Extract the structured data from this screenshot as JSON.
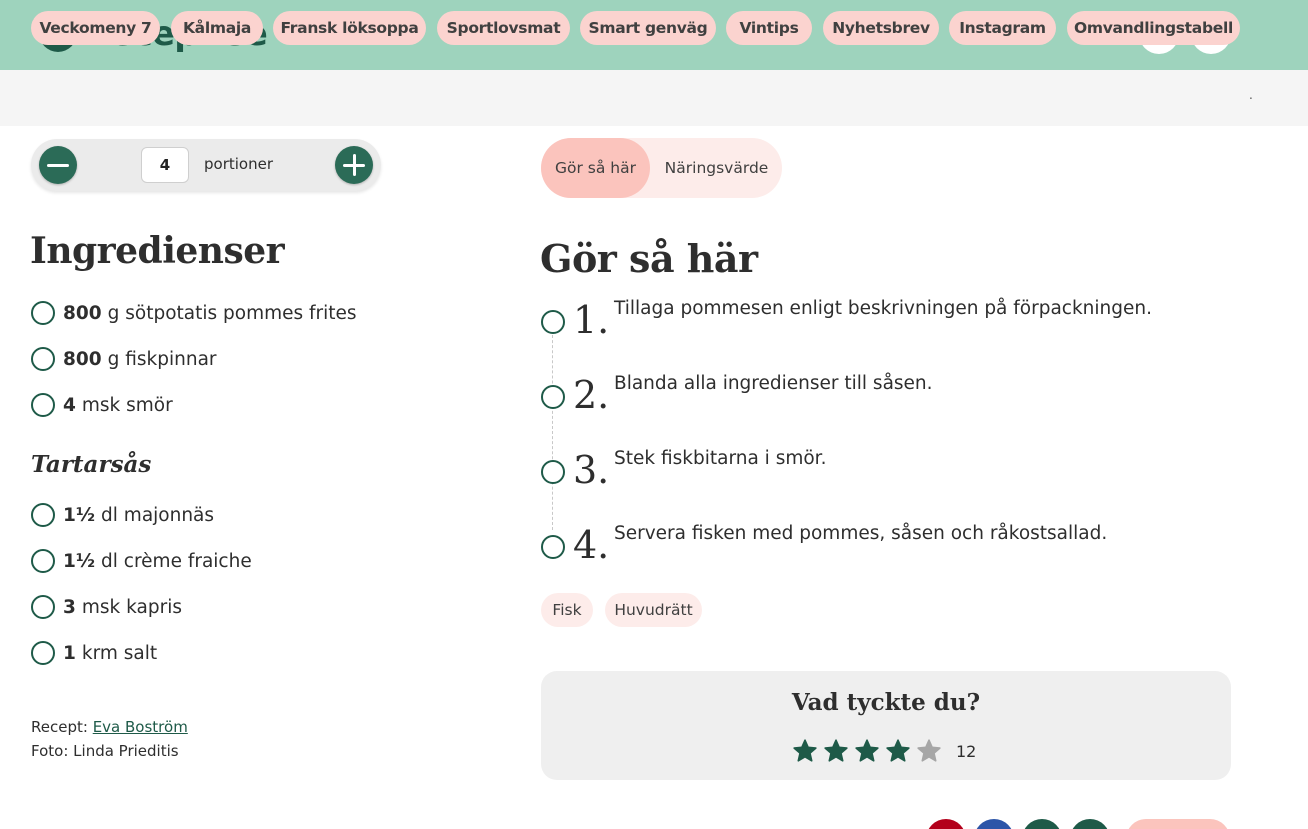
{
  "header": {
    "logo_text": "Recept.se",
    "search_icon": "search-icon",
    "account_icon": "user-icon",
    "background_color": "#9ed3bd",
    "brand_color": "#1e5a48"
  },
  "nav_chips": [
    "Veckomeny 7",
    "Kålmaja",
    "Fransk löksoppa",
    "Sportlovsmat",
    "Smart genväg",
    "Vintips",
    "Nyhetsbrev",
    "Instagram",
    "Omvandlingstabell"
  ],
  "nav_overflow": ".",
  "portions": {
    "value": "4",
    "label": "portioner",
    "minus_icon": "minus-icon",
    "plus_icon": "plus-icon"
  },
  "ingredients": {
    "title": "Ingredienser",
    "items": [
      {
        "amount": "800",
        "text": "g sötpotatis pommes frites"
      },
      {
        "amount": "800",
        "text": "g fiskpinnar"
      },
      {
        "amount": "4",
        "text": "msk smör"
      }
    ],
    "subgroup_title": "Tartarsås",
    "subgroup_items": [
      {
        "amount": "1½",
        "text": "dl majonnäs"
      },
      {
        "amount": "1½",
        "text": "dl crème fraiche"
      },
      {
        "amount": "3",
        "text": "msk kapris"
      },
      {
        "amount": "1",
        "text": "krm salt"
      }
    ]
  },
  "credits": {
    "recipe_label": "Recept:",
    "recipe_author": "Eva Boström",
    "photo_label": "Foto:",
    "photo_author": "Linda Prieditis"
  },
  "tabs": {
    "active": "Gör så här",
    "other": "Näringsvärde"
  },
  "instructions": {
    "title": "Gör så här",
    "steps": [
      {
        "num": "1.",
        "text": "Tillaga pommesen enligt beskrivningen på förpackningen."
      },
      {
        "num": "2.",
        "text": "Blanda alla ingredienser till såsen."
      },
      {
        "num": "3.",
        "text": "Stek fiskbitarna i smör."
      },
      {
        "num": "4.",
        "text": "Servera fisken med pommes, såsen och råkostsallad."
      }
    ]
  },
  "tags": [
    "Fisk",
    "Huvudrätt"
  ],
  "rating": {
    "title": "Vad tyckte du?",
    "stars_filled": 4,
    "stars_total": 5,
    "count": "12",
    "star_icon": "star-icon",
    "filled_color": "#1e5a48",
    "empty_color": "#a6a6a6"
  },
  "share": {
    "colors": [
      "#b3001b",
      "#2d55a8",
      "#1e5a48",
      "#1e5a48"
    ],
    "button_color": "#fbc4bd"
  }
}
